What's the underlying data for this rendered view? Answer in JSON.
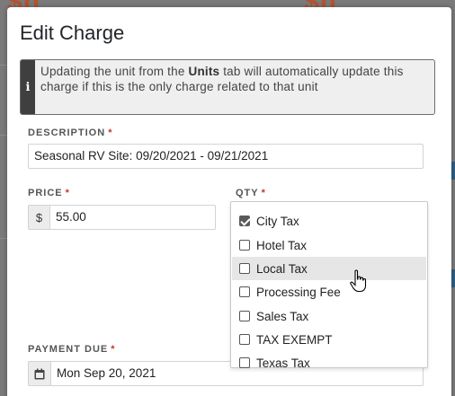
{
  "modal": {
    "title": "Edit Charge",
    "info_text_before": "Updating the unit from the ",
    "info_text_bold": "Units",
    "info_text_after": " tab will automatically update this charge if this is the only charge related to that unit"
  },
  "description": {
    "label": "DESCRIPTION",
    "required_mark": "*",
    "value": "Seasonal RV Site: 09/20/2021 - 09/21/2021"
  },
  "price": {
    "label": "PRICE",
    "required_mark": "*",
    "currency": "$",
    "value": "55.00"
  },
  "qty": {
    "label": "QTY",
    "required_mark": "*"
  },
  "payment_due": {
    "label": "PAYMENT DUE",
    "required_mark": "*",
    "value": "Mon Sep 20, 2021"
  },
  "tax_options": [
    {
      "label": "City Tax",
      "checked": true,
      "hover": false
    },
    {
      "label": "Hotel Tax",
      "checked": false,
      "hover": false
    },
    {
      "label": "Local Tax",
      "checked": false,
      "hover": true
    },
    {
      "label": "Processing Fee",
      "checked": false,
      "hover": false
    },
    {
      "label": "Sales Tax",
      "checked": false,
      "hover": false
    },
    {
      "label": "TAX EXEMPT",
      "checked": false,
      "hover": false
    },
    {
      "label": "Texas Tax",
      "checked": false,
      "hover": false
    }
  ],
  "colors": {
    "required": "#c0392b",
    "info_bar": "#3f3f3f",
    "overlay": "#7a7a7a"
  },
  "icons": [
    "info-icon",
    "calendar-icon",
    "hand-pointer-cursor"
  ]
}
